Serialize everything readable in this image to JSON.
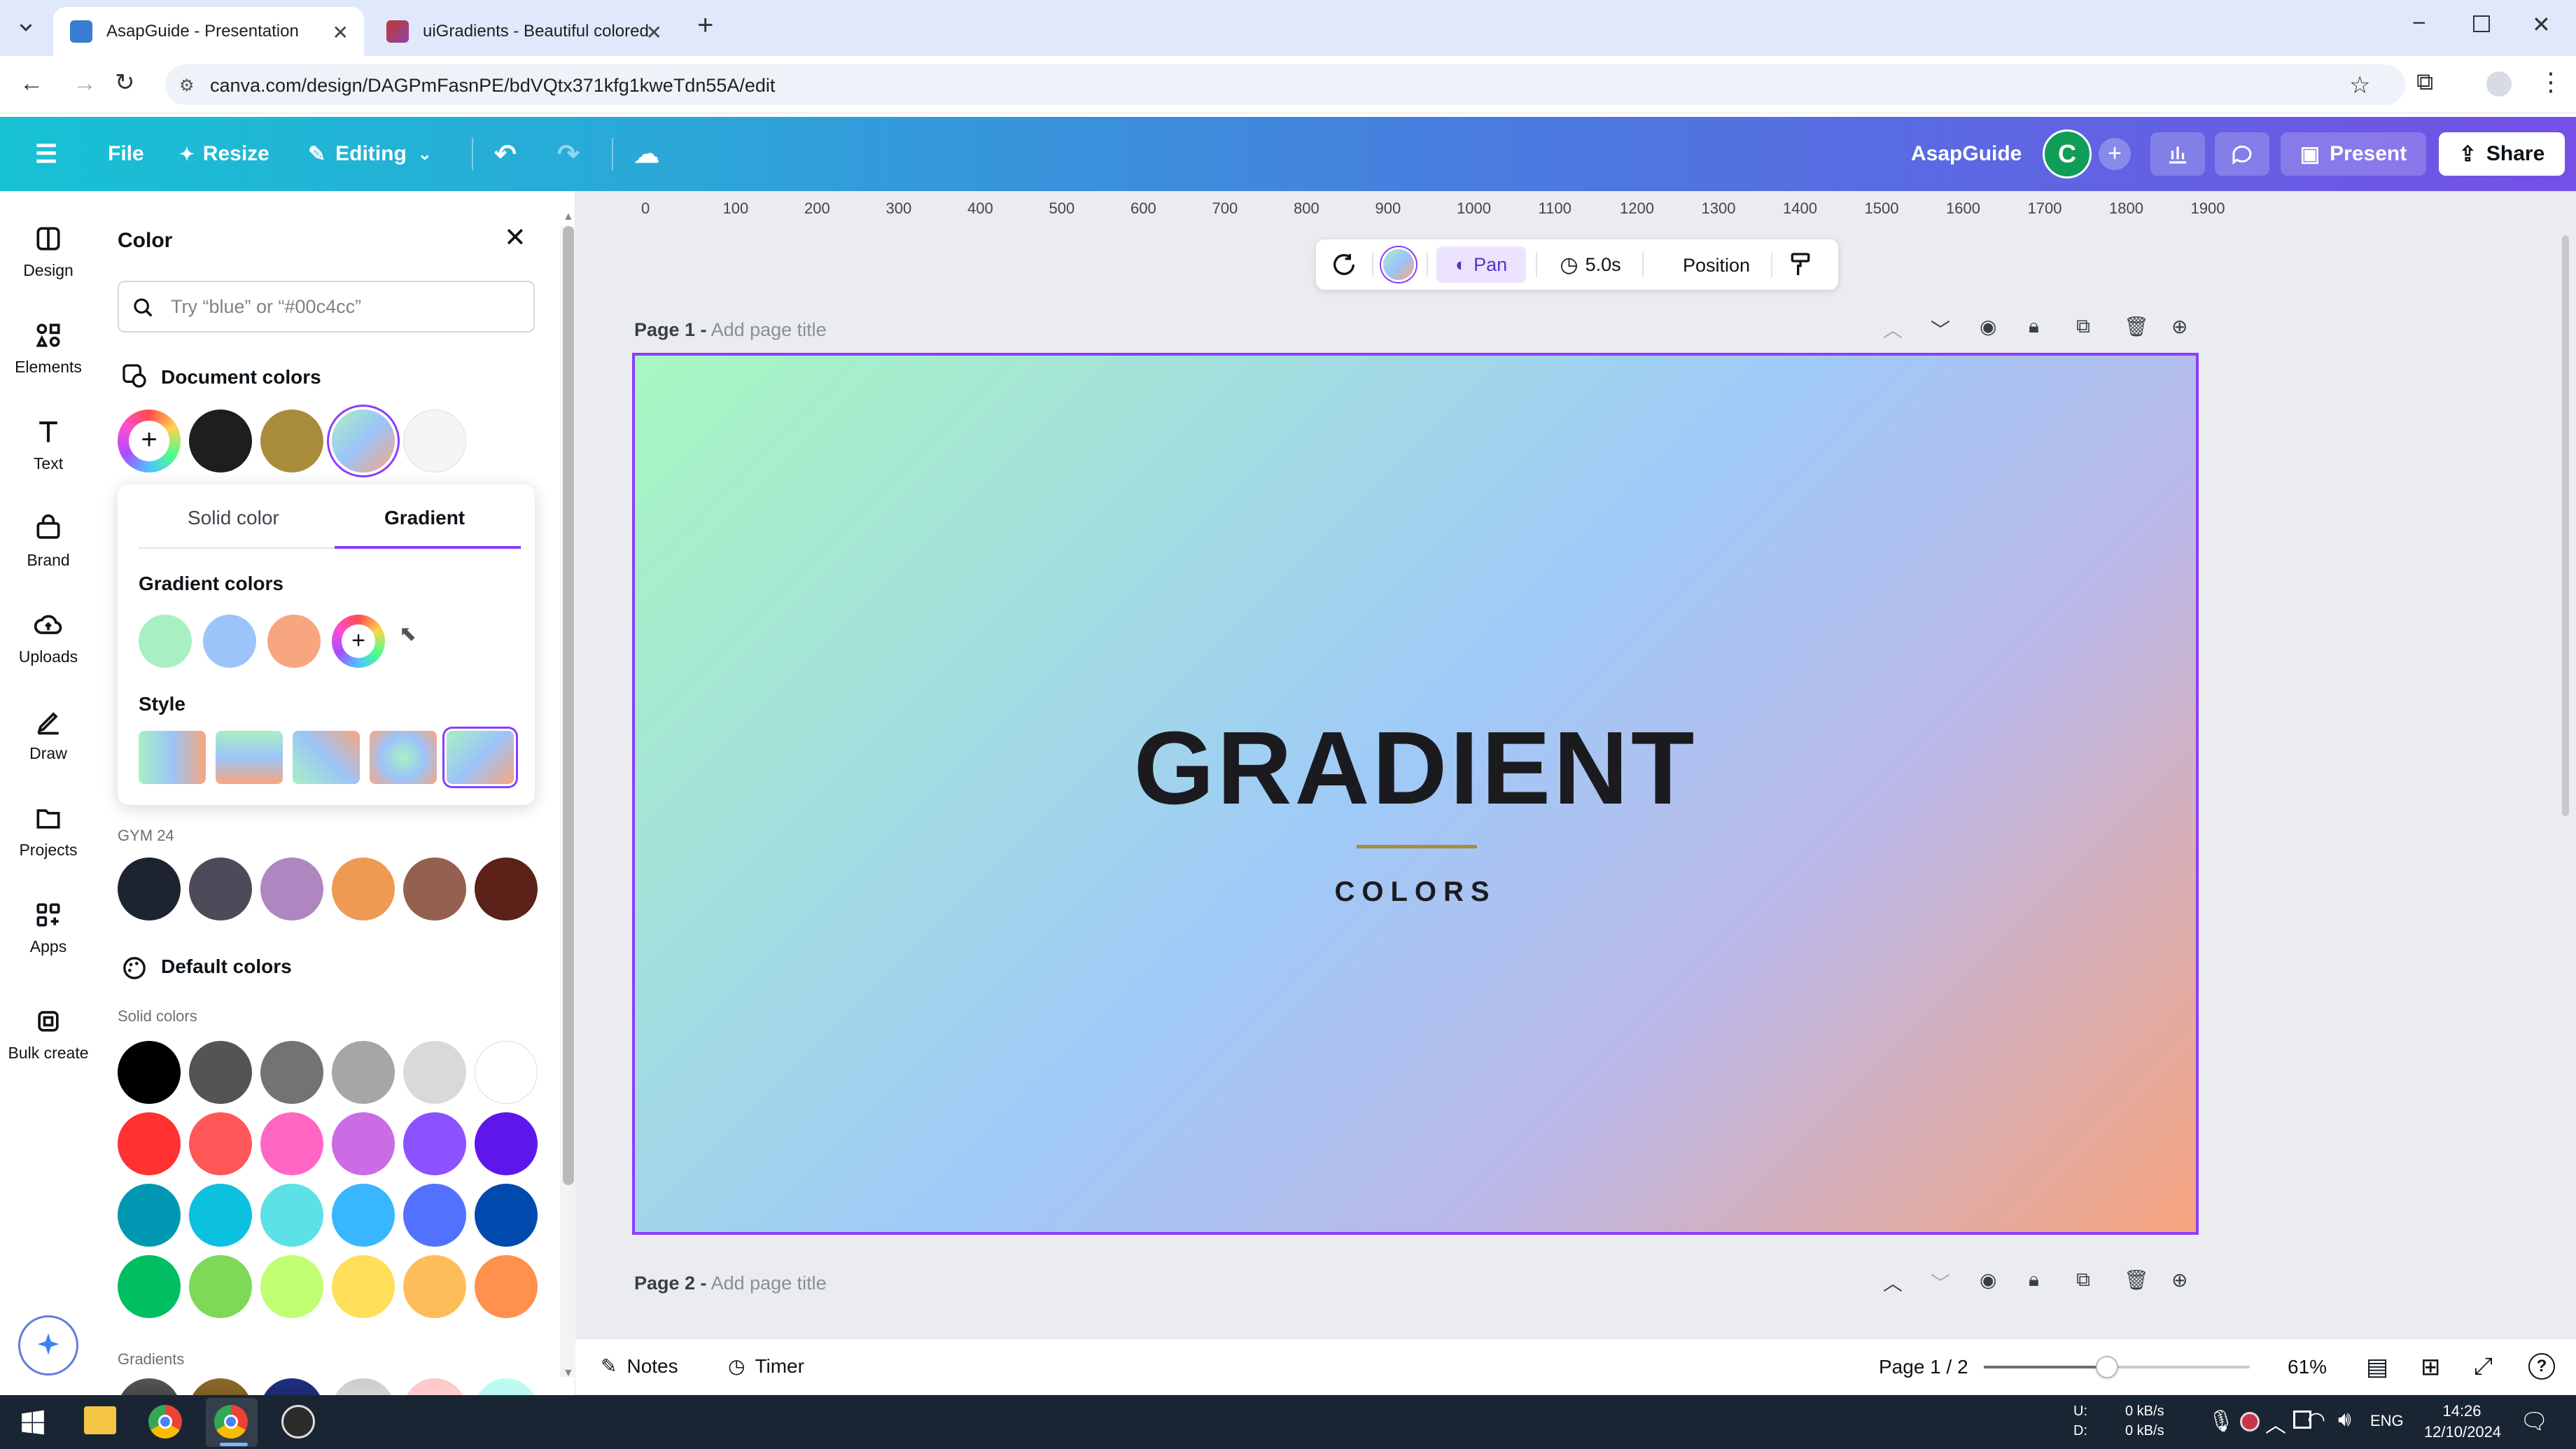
{
  "browser": {
    "tabs": [
      {
        "title": "AsapGuide - Presentation",
        "active": true
      },
      {
        "title": "uiGradients - Beautiful colored",
        "active": false
      }
    ],
    "url": "canva.com/design/DAGPmFasnPE/bdVQtx371kfg1kweTdn55A/edit"
  },
  "header": {
    "file": "File",
    "resize": "Resize",
    "editing": "Editing",
    "team": "AsapGuide",
    "avatar": "C",
    "present": "Present",
    "share": "Share"
  },
  "rail": [
    {
      "label": "Design",
      "icon": "design-icon"
    },
    {
      "label": "Elements",
      "icon": "elements-icon"
    },
    {
      "label": "Text",
      "icon": "text-icon"
    },
    {
      "label": "Brand",
      "icon": "brand-icon"
    },
    {
      "label": "Uploads",
      "icon": "uploads-icon"
    },
    {
      "label": "Draw",
      "icon": "draw-icon"
    },
    {
      "label": "Projects",
      "icon": "projects-icon"
    },
    {
      "label": "Apps",
      "icon": "apps-icon"
    },
    {
      "label": "Bulk create",
      "icon": "bulk-create-icon"
    }
  ],
  "panel": {
    "title": "Color",
    "search_placeholder": "Try “blue” or “#00c4cc”",
    "document_colors_label": "Document colors",
    "document_colors": [
      "#1e1e1e",
      "#a98b3c",
      "gradient",
      "#f5f5f5"
    ],
    "gym_label": "GYM 24",
    "gym_colors": [
      "#1d2430",
      "#4f4a5a",
      "#b086c0",
      "#ef9a53",
      "#94604f",
      "#5c2118"
    ],
    "default_colors_label": "Default colors",
    "solid_colors_label": "Solid colors",
    "solid_colors": [
      [
        "#000000",
        "#545454",
        "#737373",
        "#a6a6a6",
        "#d9d9d9",
        "#ffffff"
      ],
      [
        "#ff3131",
        "#ff5757",
        "#ff66c4",
        "#cb6ce6",
        "#8c52ff",
        "#5e17eb"
      ],
      [
        "#0097b2",
        "#0cc0df",
        "#5ce1e6",
        "#38b6ff",
        "#5271ff",
        "#004aad"
      ],
      [
        "#00bf63",
        "#7ed957",
        "#c1ff72",
        "#ffde59",
        "#ffbd59",
        "#ff914d"
      ]
    ],
    "gradients_label": "Gradients"
  },
  "gradient_popover": {
    "tab_solid": "Solid color",
    "tab_gradient": "Gradient",
    "gradient_colors_label": "Gradient colors",
    "gradient_colors": [
      "#a8f0c3",
      "#9cc4f9",
      "#f7a67f"
    ],
    "style_label": "Style"
  },
  "toolbar": {
    "pan": "Pan",
    "duration": "5.0s",
    "position": "Position"
  },
  "pages": [
    {
      "label": "Page 1 -",
      "title_placeholder": "Add page title"
    },
    {
      "label": "Page 2 -",
      "title_placeholder": "Add page title"
    }
  ],
  "slide": {
    "title": "GRADIENT",
    "subtitle": "COLORS"
  },
  "ruler": [
    "0",
    "100",
    "200",
    "300",
    "400",
    "500",
    "600",
    "700",
    "800",
    "900",
    "1000",
    "1100",
    "1200",
    "1300",
    "1400",
    "1500",
    "1600",
    "1700",
    "1800",
    "1900"
  ],
  "footer": {
    "notes": "Notes",
    "timer": "Timer",
    "page_indicator": "Page 1 / 2",
    "zoom": "61%"
  },
  "taskbar": {
    "net_up_label": "U:",
    "net_down_label": "D:",
    "net_up": "0 kB/s",
    "net_down": "0 kB/s",
    "lang": "ENG",
    "time": "14:26",
    "date": "12/10/2024"
  }
}
